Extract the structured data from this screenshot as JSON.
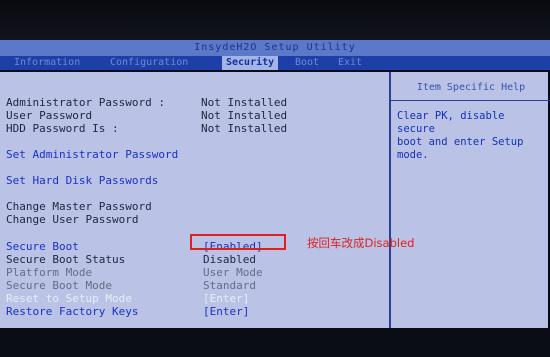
{
  "window": {
    "title": "InsydeH2O Setup Utility"
  },
  "menu": [
    {
      "label": "Information"
    },
    {
      "label": "Configuration"
    },
    {
      "label": "Security",
      "active": true
    },
    {
      "label": "Boot"
    },
    {
      "label": "Exit"
    }
  ],
  "security": {
    "admin_password_label": "Administrator Password :",
    "admin_password_value": "Not Installed",
    "user_password_label": "User Password",
    "user_password_value": "Not Installed",
    "hdd_password_label": "HDD Password Is :",
    "hdd_password_value": "Not Installed",
    "set_admin_password": "Set Administrator Password",
    "set_hdd_passwords": "Set Hard Disk Passwords",
    "change_master_password": "Change Master Password",
    "change_user_password": "Change User Password",
    "secure_boot_label": "Secure Boot",
    "secure_boot_value": "[Enabled]",
    "secure_boot_status_label": "Secure Boot Status",
    "secure_boot_status_value": "Disabled",
    "platform_mode_label": "Platform Mode",
    "platform_mode_value": "User Mode",
    "secure_boot_mode_label": "Secure Boot Mode",
    "secure_boot_mode_value": "Standard",
    "reset_setup_mode_label": "Reset to Setup Mode",
    "reset_setup_mode_value": "[Enter]",
    "restore_factory_keys_label": "Restore Factory Keys",
    "restore_factory_keys_value": "[Enter]"
  },
  "help": {
    "header": "Item Specific Help",
    "text": "Clear PK, disable secure\nboot and enter Setup\nmode."
  },
  "annotation": {
    "text": "按回车改成Disabled",
    "color": "#e02020"
  },
  "colors": {
    "menubar": "#1f3fa8",
    "panel": "#bac3e5",
    "highlight": "#e02020"
  }
}
